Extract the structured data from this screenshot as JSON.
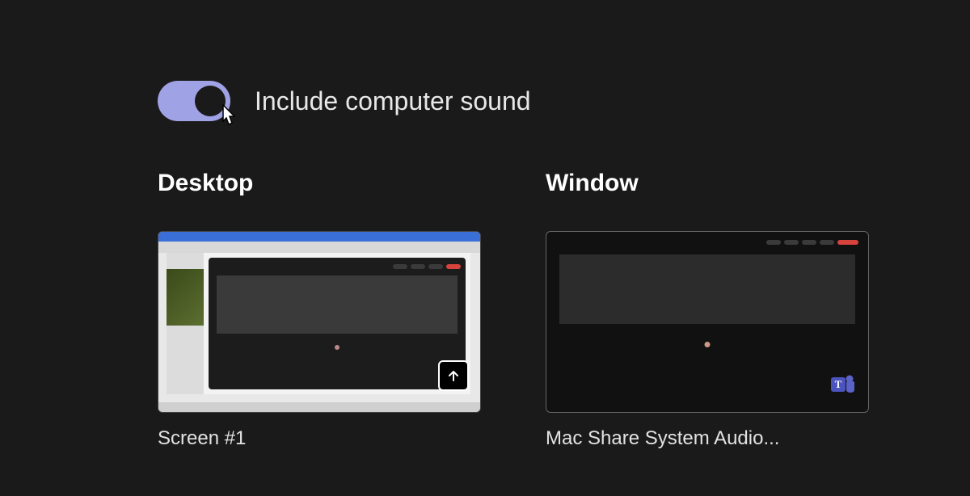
{
  "toggle": {
    "label": "Include computer sound",
    "state": "on"
  },
  "sections": {
    "desktop": {
      "heading": "Desktop",
      "items": [
        {
          "label": "Screen #1"
        }
      ]
    },
    "window": {
      "heading": "Window",
      "items": [
        {
          "label": "Mac Share System Audio..."
        }
      ]
    }
  },
  "colors": {
    "toggle_on_bg": "#a0a2e6",
    "panel_bg": "#1a1a1a"
  }
}
